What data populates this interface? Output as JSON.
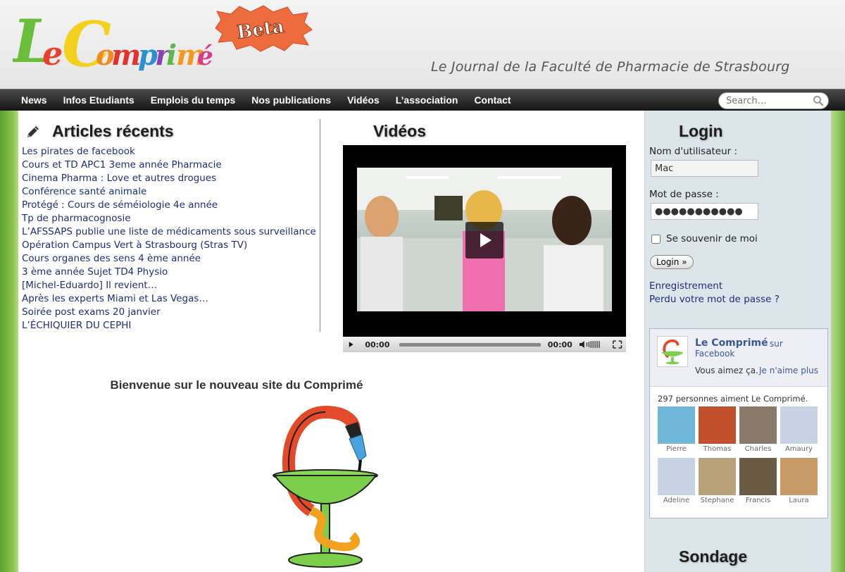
{
  "header": {
    "logo_text": "Le Comprimé",
    "beta": "Beta",
    "tagline": "Le Journal de la Faculté de Pharmacie de Strasbourg"
  },
  "nav": {
    "items": [
      "News",
      "Infos Etudiants",
      "Emplois du temps",
      "Nos publications",
      "Vidéos",
      "L’association",
      "Contact"
    ],
    "search_placeholder": "Search…"
  },
  "articles": {
    "title": "Articles récents",
    "items": [
      "Les pirates de facebook",
      "Cours et TD APC1 3eme année Pharmacie",
      "Cinema Pharma : Love et autres drogues",
      "Conférence santé animale",
      "Protégé : Cours de séméiologie 4e année",
      "Tp de pharmacognosie",
      "L’AFSSAPS publie une liste de médicaments sous surveillance",
      "Opération Campus Vert à Strasbourg (Stras TV)",
      "Cours organes des sens 4 ème année",
      "3 ème année Sujet TD4 Physio",
      "[Michel-Eduardo] Il revient…",
      "Après les experts Miami et Las Vegas…",
      "Soirée post exams 20 janvier",
      "L’ÉCHIQUIER DU CEPHI"
    ]
  },
  "videos": {
    "title": "Vidéos",
    "time_current": "00:00",
    "time_total": "00:00"
  },
  "welcome": "Bienvenue sur le nouveau site du Comprimé",
  "login": {
    "title": "Login",
    "username_label": "Nom d'utilisateur :",
    "username_value": "Mac",
    "password_label": "Mot de passe :",
    "password_value": "●●●●●●●●●●●",
    "remember_label": "Se souvenir de moi",
    "button": "Login »",
    "register": "Enregistrement",
    "lost_password": "Perdu votre mot de passe ?"
  },
  "facebook": {
    "page_name": "Le Comprimé",
    "sur": "sur",
    "facebook_word": "Facebook",
    "likes_text": "Vous aimez ça.",
    "unlike": "Je n'aime plus",
    "count_text": "297 personnes aiment Le Comprimé.",
    "fans": [
      {
        "name": "Pierre",
        "color": "#6fb7d9"
      },
      {
        "name": "Thomas",
        "color": "#c0502a"
      },
      {
        "name": "Charles",
        "color": "#8a7a6a"
      },
      {
        "name": "Amaury",
        "color": "#c9d3e6"
      },
      {
        "name": "Adeline",
        "color": "#c9d3e6"
      },
      {
        "name": "Stephane",
        "color": "#b8a27a"
      },
      {
        "name": "Francis",
        "color": "#6b5a44"
      },
      {
        "name": "Laura",
        "color": "#c79a66"
      }
    ]
  },
  "poll": {
    "title": "Sondage"
  }
}
